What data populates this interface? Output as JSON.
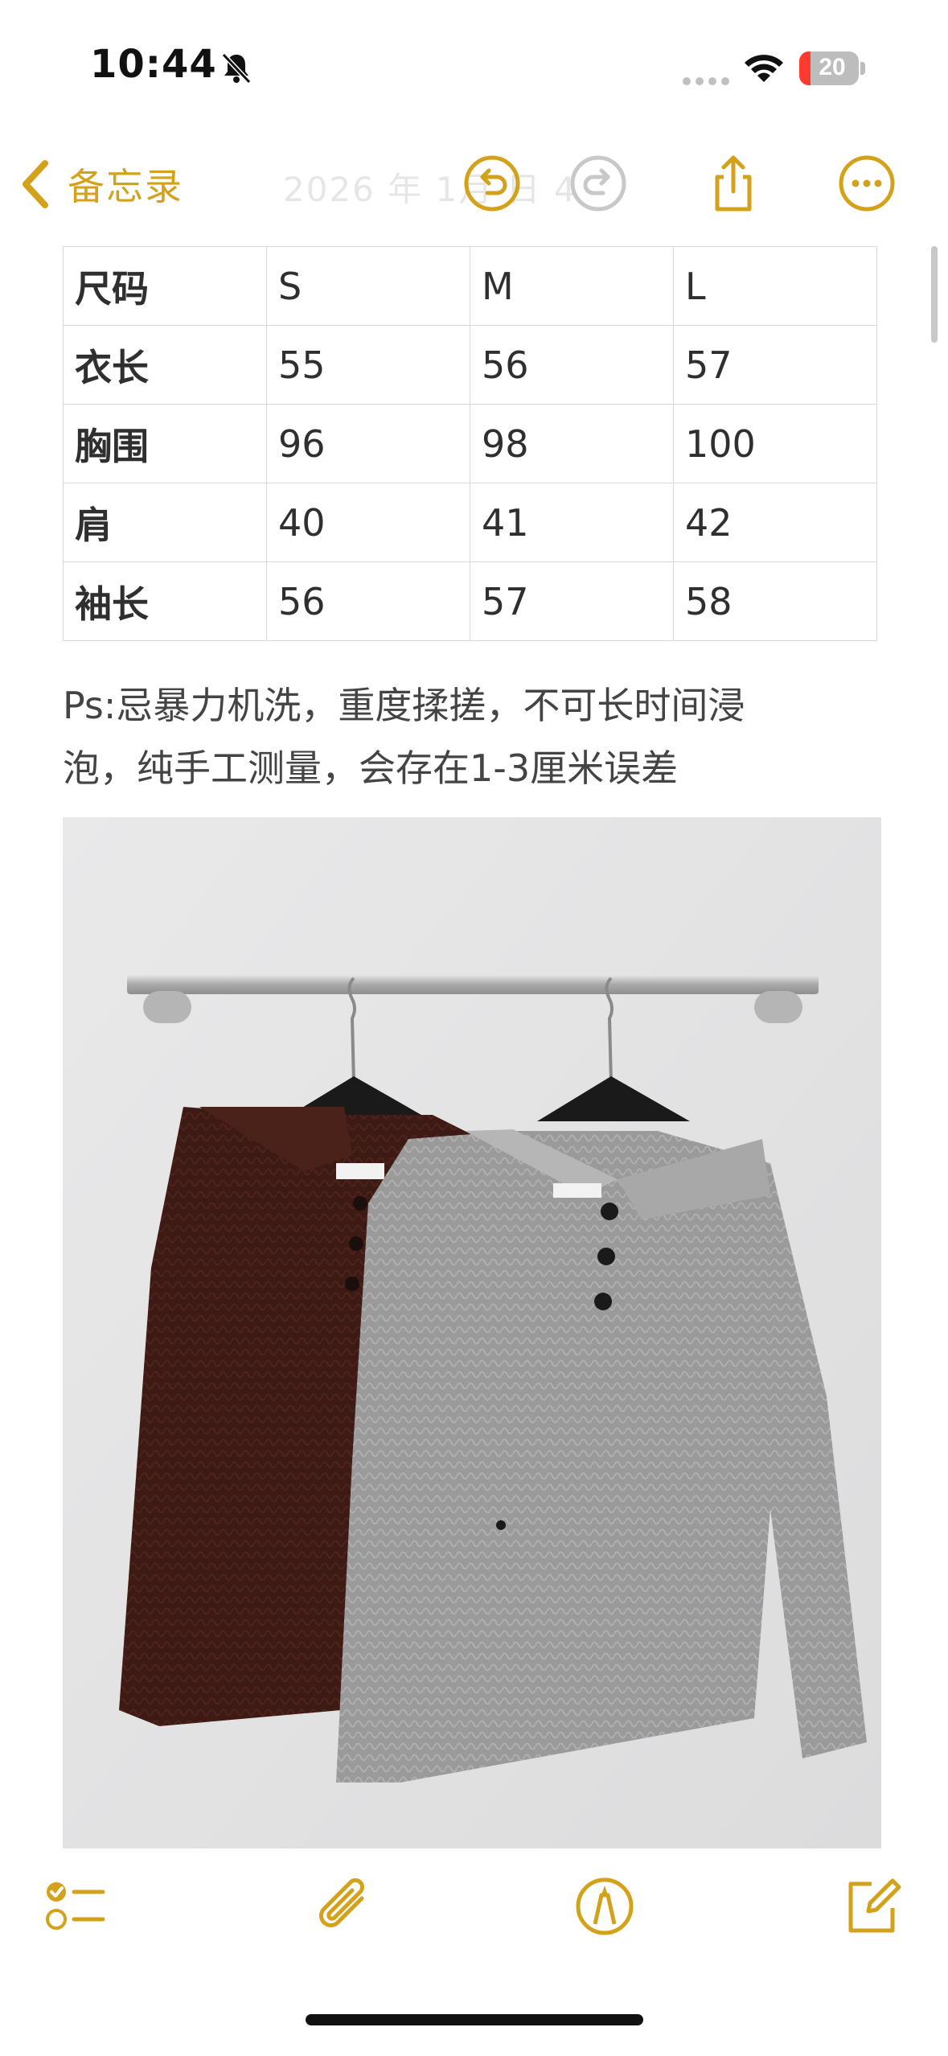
{
  "status_bar": {
    "time": "10:44",
    "battery_percent": "20",
    "icons": [
      "bell-slash-icon",
      "signal-dots-icon",
      "wifi-icon",
      "battery-charging-icon"
    ]
  },
  "nav": {
    "back_label": "备忘录",
    "faded_title": "2026 年 1月 日 4",
    "icons": [
      "chevron-left-icon",
      "undo-icon",
      "redo-icon",
      "share-icon",
      "more-icon"
    ],
    "accent_color": "#d4a21a"
  },
  "size_table": {
    "rows": [
      [
        "尺码",
        "S",
        "M",
        "L"
      ],
      [
        "衣长",
        "55",
        "56",
        "57"
      ],
      [
        "胸围",
        "96",
        "98",
        "100"
      ],
      [
        "肩",
        "40",
        "41",
        "42"
      ],
      [
        "袖长",
        "56",
        "57",
        "58"
      ]
    ]
  },
  "note": {
    "line1": "Ps:忌暴力机洗，重度揉搓，不可长时间浸",
    "line2": "泡，纯手工测量，会存在1-3厘米误差"
  },
  "photo": {
    "description_icon": "sweater-photo"
  },
  "toolbar": {
    "icons": [
      "checklist-icon",
      "paperclip-icon",
      "markup-pen-icon",
      "compose-icon"
    ]
  }
}
